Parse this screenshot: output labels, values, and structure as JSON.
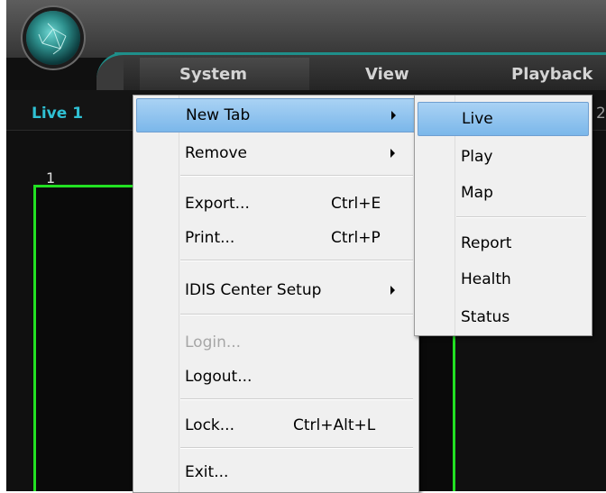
{
  "menubar": {
    "items": [
      {
        "label": "System"
      },
      {
        "label": "View"
      },
      {
        "label": "Playback"
      }
    ]
  },
  "tabs": {
    "active_label": "Live 1",
    "next_label_partial": "2"
  },
  "viewport": {
    "number": "1"
  },
  "system_menu": {
    "items": [
      {
        "label": "New Tab",
        "shortcut": "",
        "submenu": true
      },
      {
        "label": "Remove",
        "shortcut": "",
        "submenu": true
      },
      {
        "label": "Export...",
        "shortcut": "Ctrl+E"
      },
      {
        "label": "Print...",
        "shortcut": "Ctrl+P"
      },
      {
        "label": "IDIS Center Setup",
        "shortcut": "",
        "submenu": true
      },
      {
        "label": "Login...",
        "shortcut": "",
        "disabled": true
      },
      {
        "label": "Logout...",
        "shortcut": ""
      },
      {
        "label": "Lock...",
        "shortcut": "Ctrl+Alt+L"
      },
      {
        "label": "Exit...",
        "shortcut": ""
      }
    ]
  },
  "new_tab_submenu": {
    "items": [
      {
        "label": "Live"
      },
      {
        "label": "Play"
      },
      {
        "label": "Map"
      },
      {
        "label": "Report"
      },
      {
        "label": "Health"
      },
      {
        "label": "Status"
      }
    ]
  },
  "colors": {
    "accent_teal": "#1f8f8a",
    "active_tab_text": "#2fc1d4",
    "viewport_border": "#22e022",
    "menu_highlight": "#7bb7ea"
  },
  "icons": {
    "logo": "network-globe-logo-icon",
    "submenu": "submenu-arrow-icon"
  }
}
